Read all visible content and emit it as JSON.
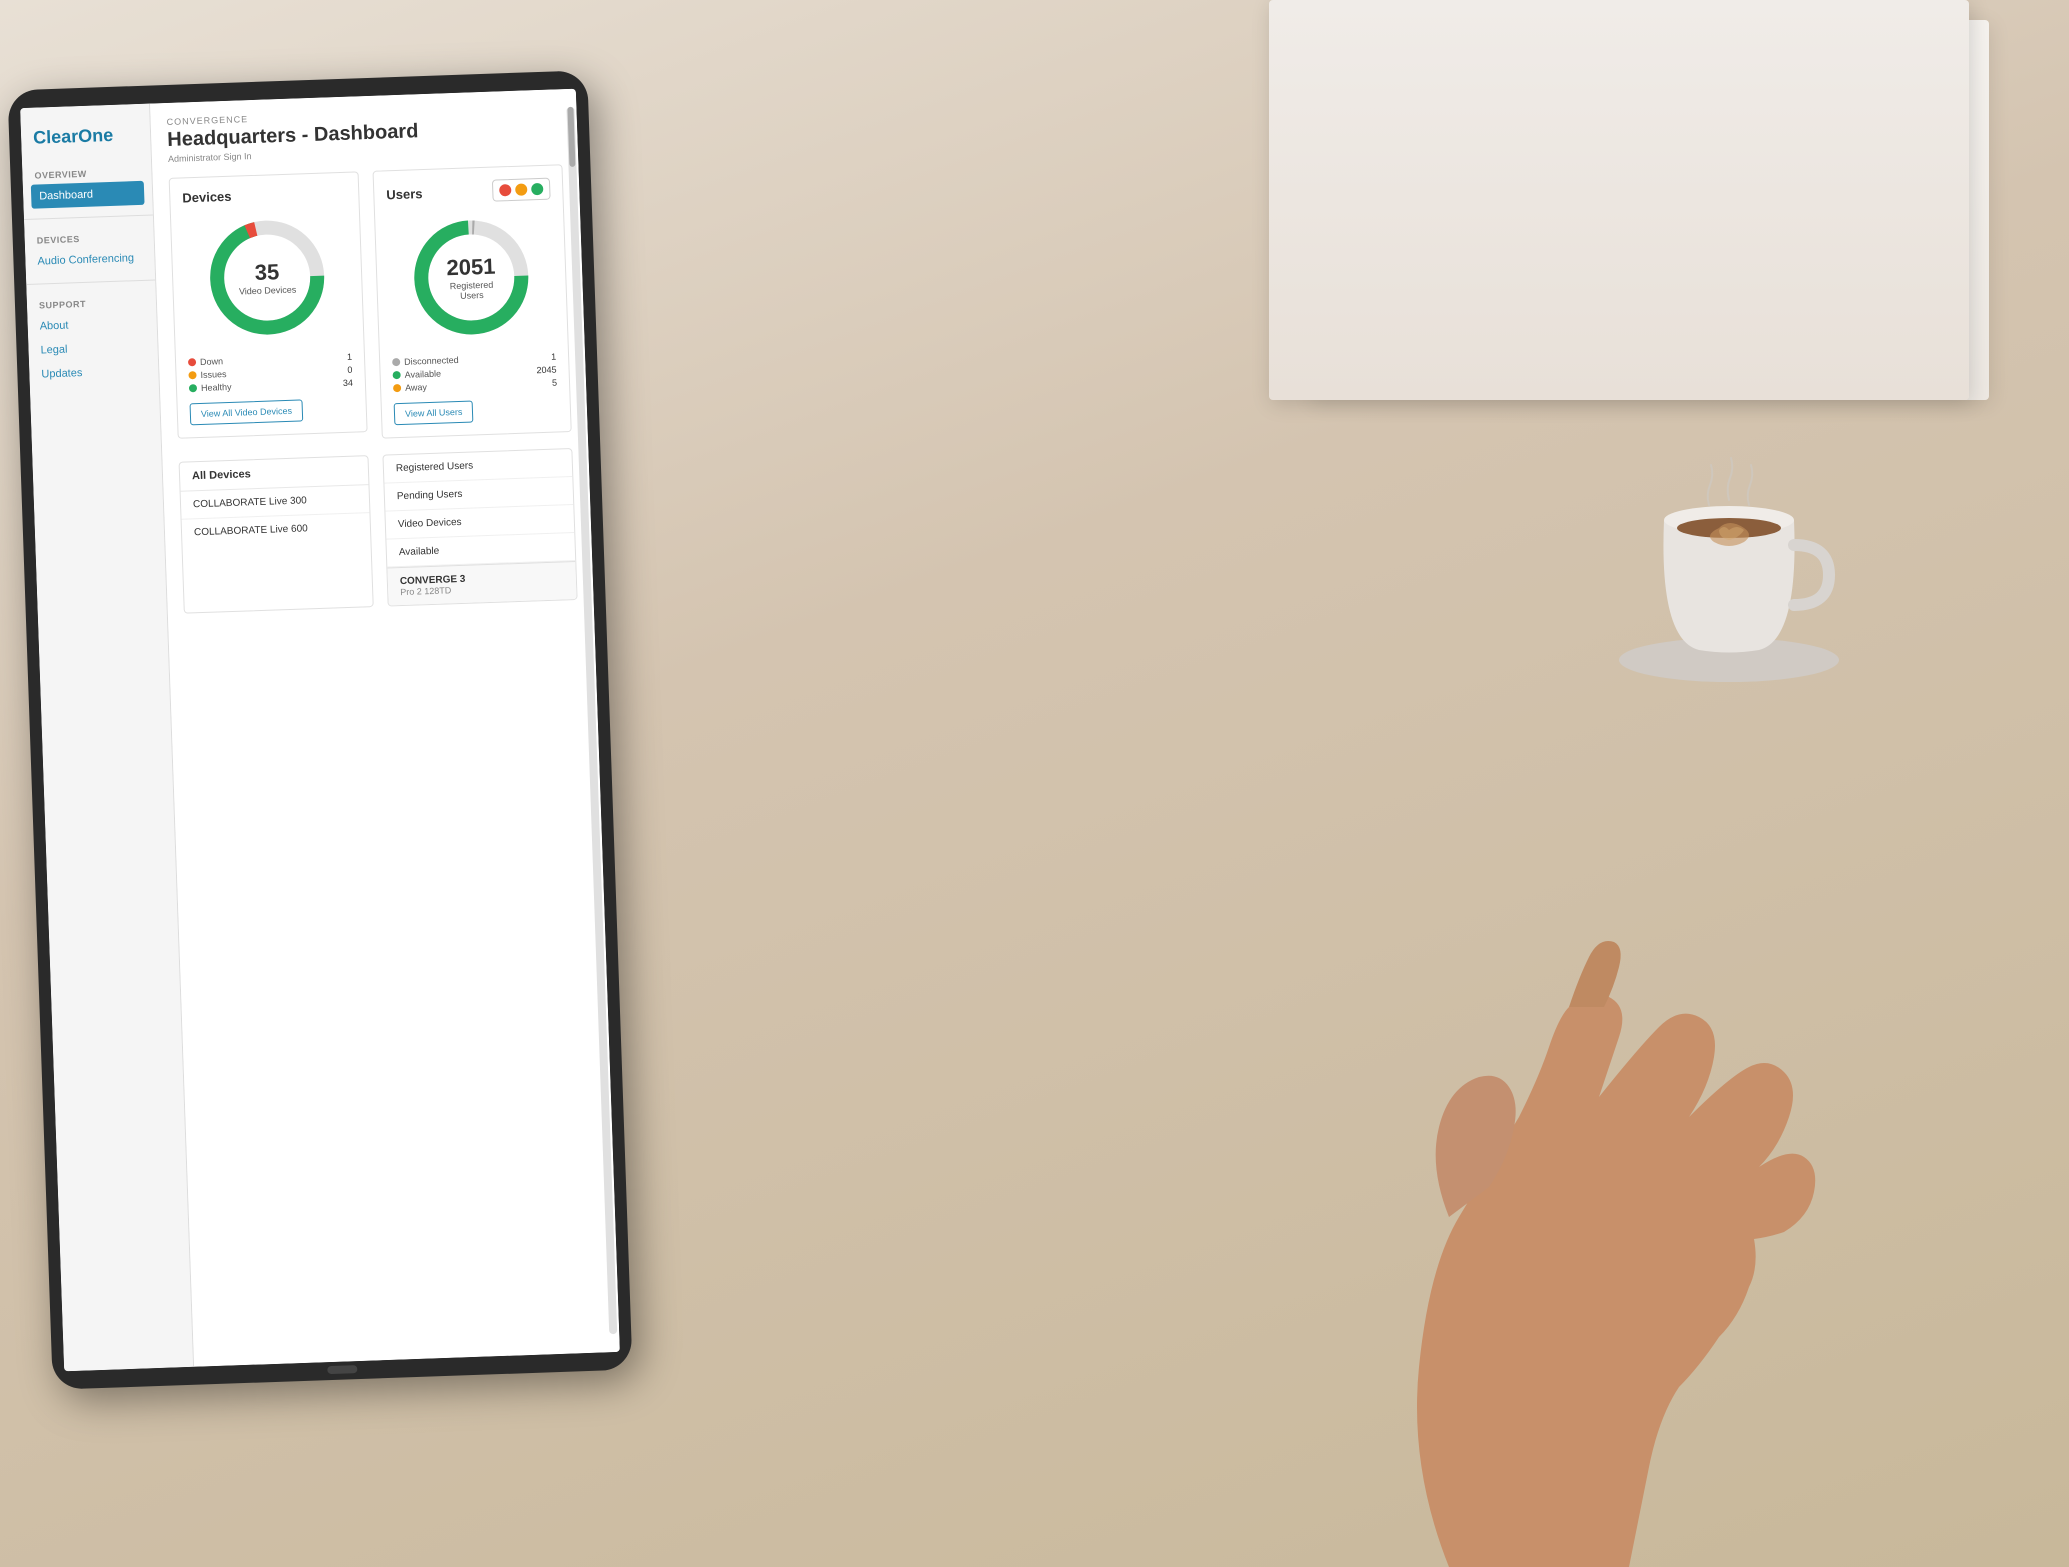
{
  "background": {
    "color": "#d4c4b0"
  },
  "app": {
    "brand": "ClearOne",
    "section": "CONVERGENCE",
    "title": "Headquarters - Dashboard",
    "subtitle": "Administrator Sign In"
  },
  "sidebar": {
    "overview_label": "OVERVIEW",
    "dashboard_label": "Dashboard",
    "devices_label": "DEVICES",
    "audio_conferencing_label": "Audio Conferencing",
    "support_label": "SUPPORT",
    "about_label": "About",
    "legal_label": "Legal",
    "updates_label": "Updates"
  },
  "devices_card": {
    "title": "Devices",
    "donut_number": "35",
    "donut_label": "Video Devices",
    "legend": [
      {
        "color": "red",
        "label": "Down",
        "value": "1"
      },
      {
        "color": "yellow",
        "label": "Issues",
        "value": "0"
      },
      {
        "color": "green",
        "label": "Healthy",
        "value": "34"
      }
    ],
    "view_all_button": "View All Video Devices"
  },
  "users_card": {
    "title": "Users",
    "donut_number": "2051",
    "donut_label": "Registered Users",
    "legend": [
      {
        "color": "gray",
        "label": "Disconnected",
        "value": "1"
      },
      {
        "color": "green",
        "label": "Available",
        "value": "2045"
      },
      {
        "color": "yellow",
        "label": "Away",
        "value": "5"
      }
    ],
    "view_all_button": "View All Users"
  },
  "traffic_lights": {
    "colors": [
      "red",
      "yellow",
      "green"
    ]
  },
  "all_devices": {
    "header": "All Devices",
    "items": [
      "COLLABORATE Live 300",
      "COLLABORATE Live 600"
    ]
  },
  "users_list": {
    "items": [
      "Registered Users",
      "Pending Users",
      "Video Devices",
      "Available"
    ]
  },
  "converge": {
    "title": "CONVERGE 3",
    "subtitle": "Pro 2 128TD"
  }
}
